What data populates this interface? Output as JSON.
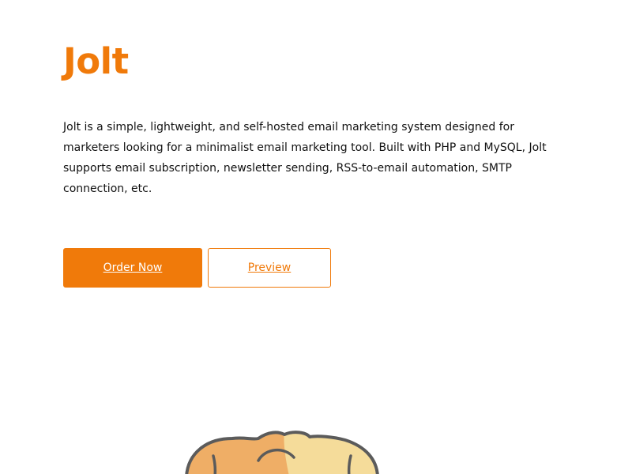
{
  "product": {
    "title": "Jolt",
    "description": "Jolt is a simple, lightweight, and self-hosted email marketing system designed for marketers looking for a minimalist email marketing tool. Built with PHP and MySQL, Jolt supports email subscription, newsletter sending, RSS-to-email automation, SMTP connection, etc."
  },
  "actions": {
    "order_label": "Order Now",
    "preview_label": "Preview"
  },
  "colors": {
    "accent": "#f07a0a",
    "mascot_left": "#efae66",
    "mascot_right": "#f5dc9a",
    "mascot_outline": "#5b5b5b"
  }
}
